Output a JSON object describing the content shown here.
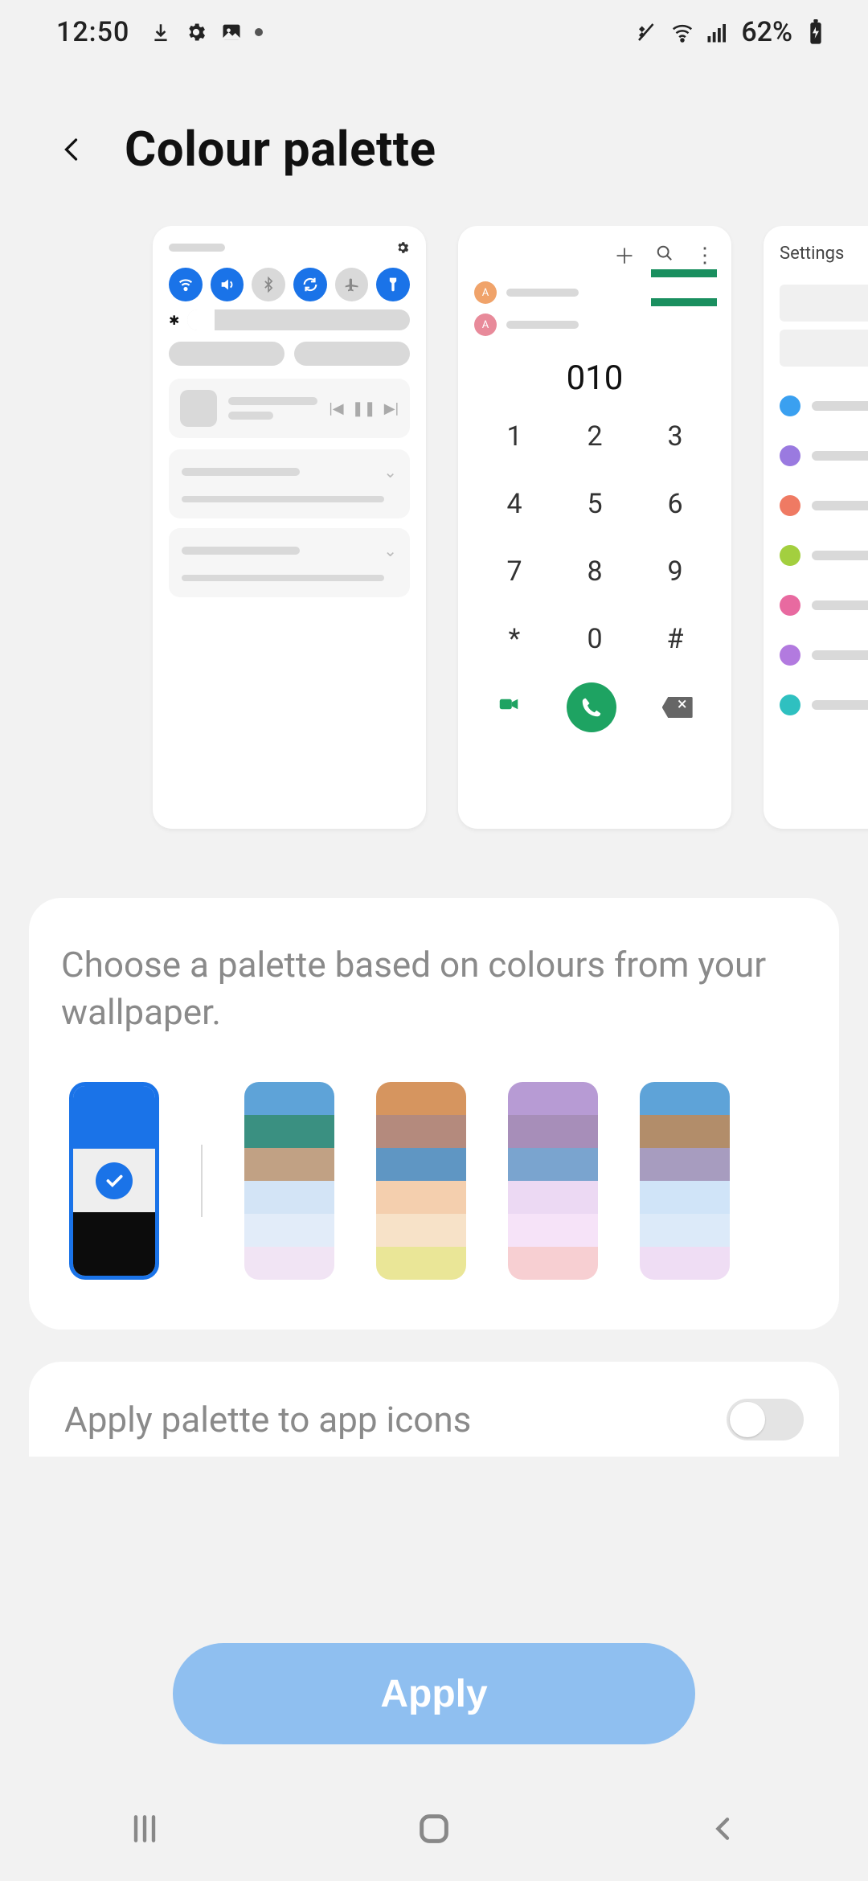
{
  "status": {
    "time": "12:50",
    "battery": "62%"
  },
  "header": {
    "title": "Colour palette"
  },
  "previews": {
    "dialer": {
      "number": "010",
      "keys": [
        "1",
        "2",
        "3",
        "4",
        "5",
        "6",
        "7",
        "8",
        "9",
        "*",
        "0",
        "#"
      ],
      "contact_initial": "A"
    },
    "settings": {
      "title": "Settings",
      "row_colors": [
        "#3aa0f0",
        "#9a7ae0",
        "#ef7a63",
        "#a3cf3f",
        "#e86aa0",
        "#b27adf",
        "#2fc0c0"
      ]
    }
  },
  "palette_section": {
    "description": "Choose a palette based on colours from your wallpaper.",
    "selected_index": 0,
    "palettes": [
      {
        "colors": [
          "#1a73e8",
          "#eeeeee",
          "#0c0c0c"
        ],
        "selected": true
      },
      {
        "colors": [
          "#5ea3d8",
          "#3a9081",
          "#c1a184",
          "#d3e4f6",
          "#e2ecf9",
          "#f1e4f4"
        ]
      },
      {
        "colors": [
          "#d6955f",
          "#b48a7d",
          "#5f96c3",
          "#f4cfae",
          "#f7e2c8",
          "#eae697"
        ]
      },
      {
        "colors": [
          "#b79bd4",
          "#a78eb9",
          "#7aa4cf",
          "#ecd9f3",
          "#f6e3f8",
          "#f7cfd2"
        ]
      },
      {
        "colors": [
          "#5ea3d8",
          "#b28d6a",
          "#a79cbf",
          "#d0e4f8",
          "#dceaf9",
          "#efddf4"
        ]
      }
    ]
  },
  "apply_icons": {
    "label": "Apply palette to app icons",
    "enabled": false
  },
  "apply_button": {
    "label": "Apply"
  }
}
